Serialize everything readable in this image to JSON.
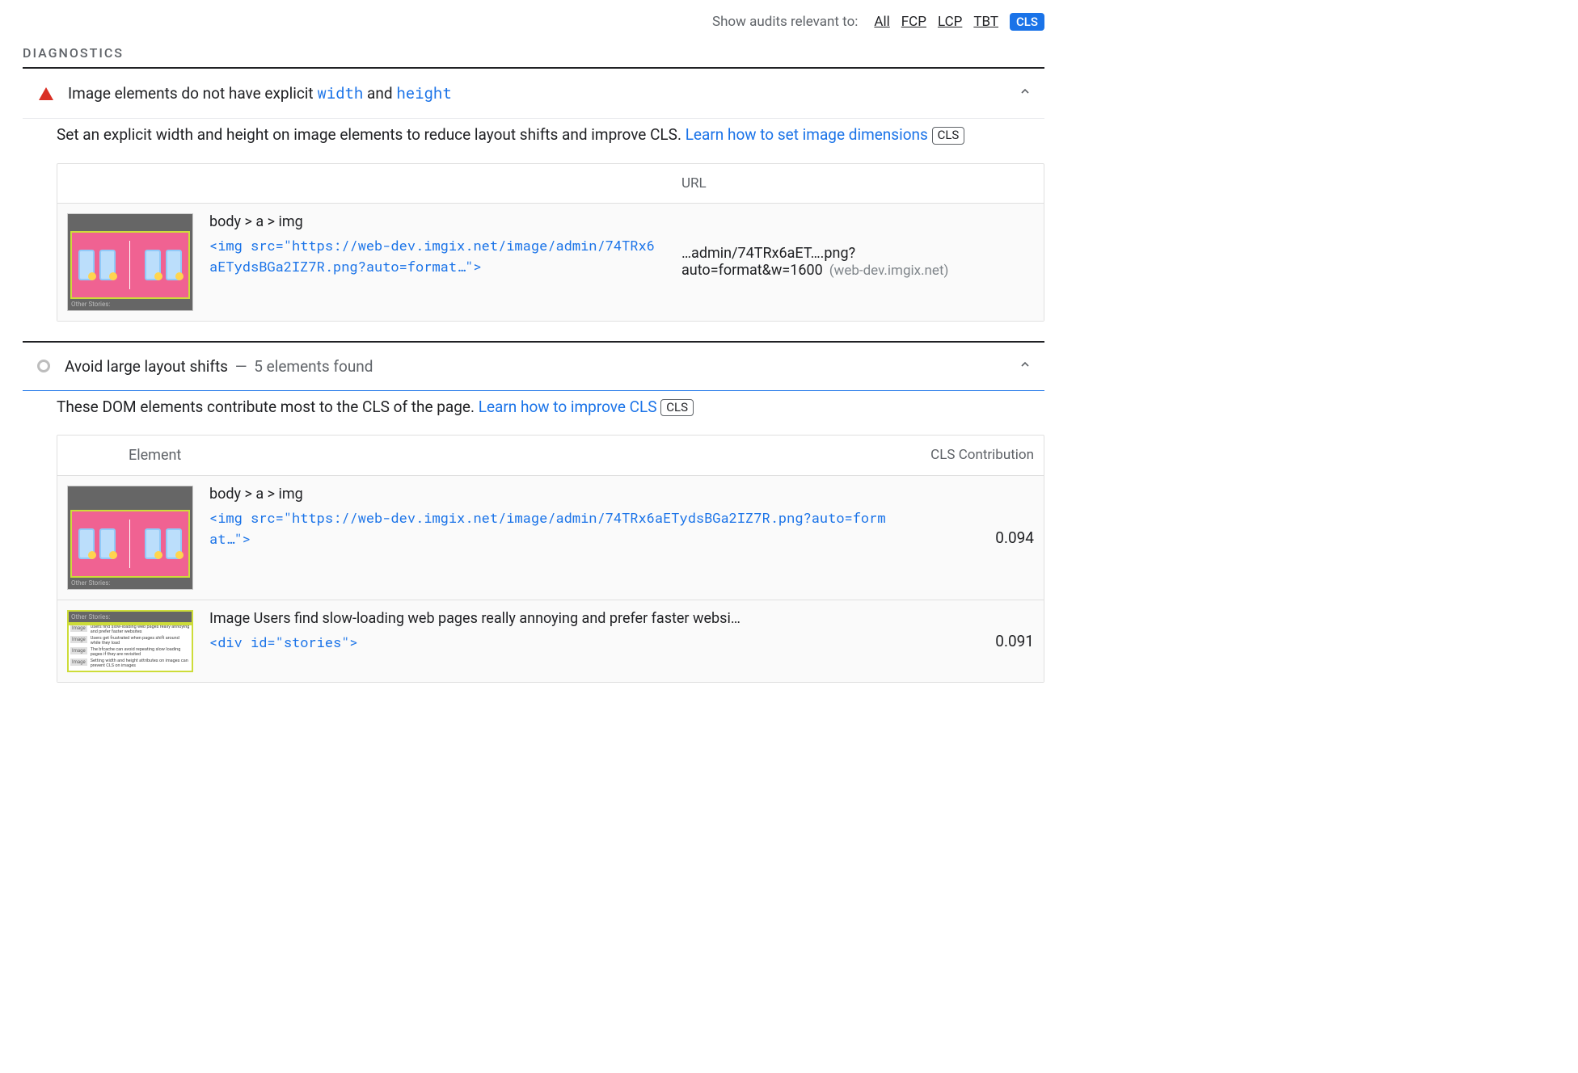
{
  "filter": {
    "label": "Show audits relevant to:",
    "all": "All",
    "fcp": "FCP",
    "lcp": "LCP",
    "tbt": "TBT",
    "cls": "CLS"
  },
  "section_title": "DIAGNOSTICS",
  "audit1": {
    "title_pre": "Image elements do not have explicit ",
    "tok1": "width",
    "mid": " and ",
    "tok2": "height",
    "desc_pre": "Set an explicit width and height on image elements to reduce layout shifts and improve CLS. ",
    "learn": "Learn how to set image dimensions",
    "badge": "CLS",
    "col_url": "URL",
    "row": {
      "path": "body > a > img",
      "snippet": "<img src=\"https://web-dev.imgix.net/image/admin/74TRx6aETydsBGa2IZ7R.png?auto=format…\">",
      "url_short": "…admin/74TRx6aET….png?auto=format&w=1600",
      "url_host": "(web-dev.imgix.net)",
      "thumb_label": "Other Stories:"
    }
  },
  "audit2": {
    "title": "Avoid large layout shifts",
    "count": "5 elements found",
    "desc_pre": "These DOM elements contribute most to the CLS of the page. ",
    "learn": "Learn how to improve CLS",
    "badge": "CLS",
    "col_el": "Element",
    "col_val": "CLS Contribution",
    "rows": [
      {
        "path": "body > a > img",
        "snippet": "<img src=\"https://web-dev.imgix.net/image/admin/74TRx6aETydsBGa2IZ7R.png?auto=format…\">",
        "value": "0.094",
        "thumb_label": "Other Stories:"
      },
      {
        "path": "Image Users find slow-loading web pages really annoying and prefer faster websi…",
        "snippet": "<div id=\"stories\">",
        "value": "0.091",
        "thumb_label": "Other Stories:",
        "stories_tag": "Image",
        "s1": "Users find slow-loading web pages really annoying and prefer faster websites",
        "s2": "Users get frustrated when pages shift around while they load",
        "s3": "The bfcache can avoid repeating slow loading pages if they are revisited",
        "s4": "Setting width and height attributes on images can prevent CLS on images"
      }
    ]
  }
}
